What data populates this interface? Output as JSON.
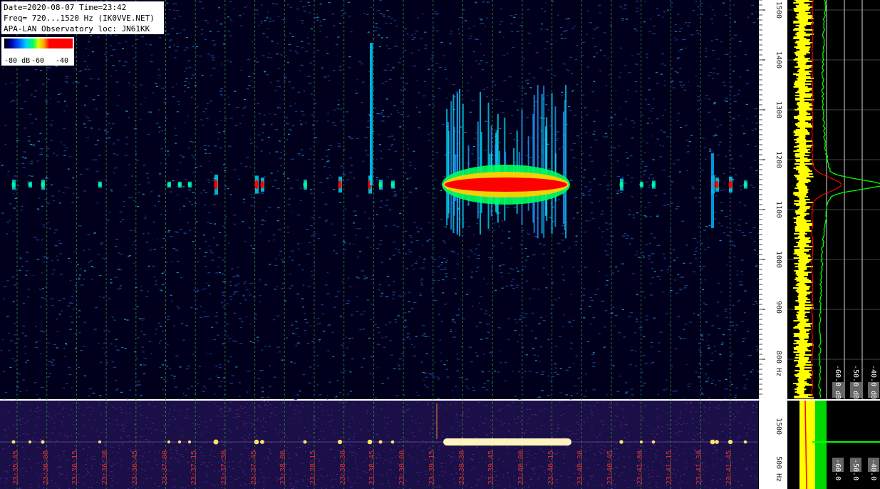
{
  "header": {
    "line1": "Date=2020-08-07 Time=23:42",
    "line2": "Freq= 720...1520 Hz (IK0VVE.NET)",
    "line3": "APA-LAN Observatory loc: JN61KK"
  },
  "color_scale": {
    "labels": [
      "-80 dB",
      "-60",
      "-40"
    ]
  },
  "colors": {
    "waterfall_bg": "#00001c",
    "lower_bg": "#1a0f46",
    "spectrum_yellow": "#ffff00",
    "spectrum_green": "#00ff00",
    "spectrum_red": "#ff0000",
    "time_label": "#d83030",
    "grid_line": "#3a9a3a"
  },
  "chart_data": {
    "type": "heatmap",
    "title": "",
    "xlabel": "",
    "ylabel": "Hz",
    "ylim": [
      720,
      1520
    ],
    "y_tick_labels": [
      "1500",
      "1400",
      "1300",
      "1200",
      "1100",
      "1000",
      "900",
      "800 Hz"
    ],
    "y_ticks": [
      1500,
      1400,
      1300,
      1200,
      1100,
      1000,
      900,
      800
    ],
    "x_tick_labels": [
      "23:35:45",
      "23:36:00",
      "23:36:15",
      "23:36:30",
      "23:36:45",
      "23:37:00",
      "23:37:15",
      "23:37:30",
      "23:37:45",
      "23:38:00",
      "23:38:15",
      "23:38:30",
      "23:38:45",
      "23:39:00",
      "23:39:15",
      "23:39:30",
      "23:39:45",
      "23:40:00",
      "23:40:15",
      "23:40:30",
      "23:40:45",
      "23:41:00",
      "23:41:15",
      "23:41:30",
      "23:41:45"
    ],
    "carrier_freq_hz": 1150,
    "spectrum_db_labels": [
      "-60.0 dB",
      "-50.0 dB",
      "-40.0 dB"
    ],
    "lower_freq_labels": [
      "1500",
      "500 Hz"
    ],
    "lower_db_labels": [
      "-60.0",
      "-50.0",
      "-40.0"
    ]
  }
}
